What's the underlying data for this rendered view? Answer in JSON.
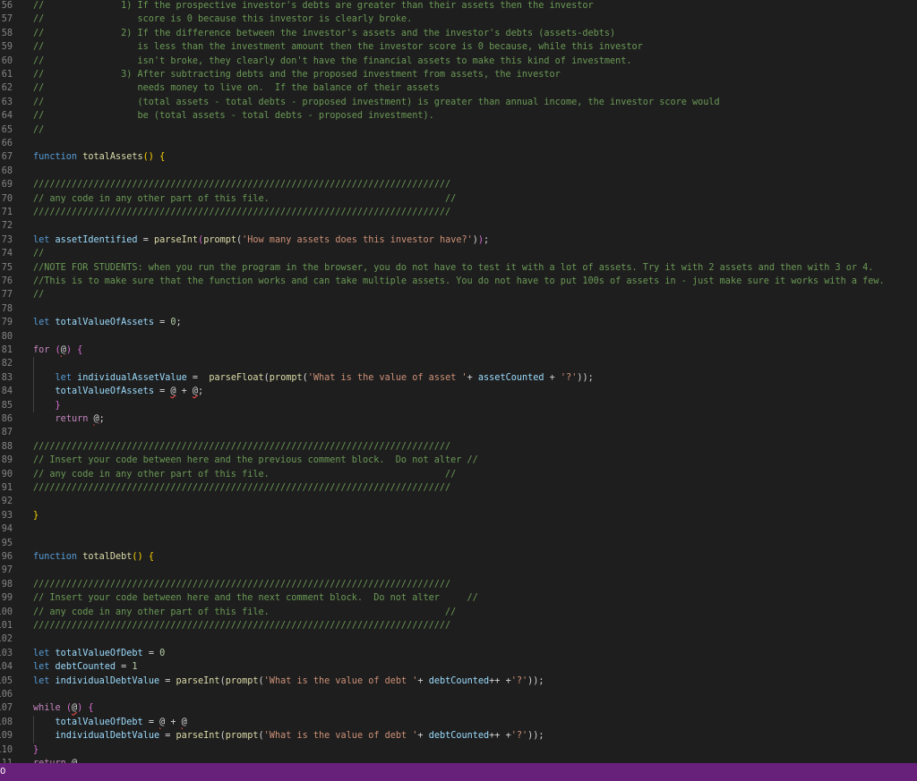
{
  "editor": {
    "first_line_number": 56,
    "lines": [
      [
        [
          "comment",
          "//              1) If the prospective investor's debts are greater than their assets then the investor"
        ]
      ],
      [
        [
          "comment",
          "//                 score is 0 because this investor is clearly broke."
        ]
      ],
      [
        [
          "comment",
          "//              2) If the difference between the investor's assets and the investor's debts (assets-debts)"
        ]
      ],
      [
        [
          "comment",
          "//                 is less than the investment amount then the investor score is 0 because, while this investor"
        ]
      ],
      [
        [
          "comment",
          "//                 isn't broke, they clearly don't have the financial assets to make this kind of investment."
        ]
      ],
      [
        [
          "comment",
          "//              3) After subtracting debts and the proposed investment from assets, the investor"
        ]
      ],
      [
        [
          "comment",
          "//                 needs money to live on.  If the balance of their assets"
        ]
      ],
      [
        [
          "comment",
          "//                 (total assets - total debts - proposed investment) is greater than annual income, the investor score would"
        ]
      ],
      [
        [
          "comment",
          "//                 be (total assets - total debts - proposed investment)."
        ]
      ],
      [
        [
          "comment",
          "//"
        ]
      ],
      [],
      [
        [
          "kw",
          "function "
        ],
        [
          "fn",
          "totalAssets"
        ],
        [
          "brace",
          "()"
        ],
        [
          "plain",
          " "
        ],
        [
          "brace",
          "{"
        ]
      ],
      [],
      [
        [
          "comment",
          "////////////////////////////////////////////////////////////////////////////"
        ]
      ],
      [
        [
          "comment",
          "// any code in any other part of this file.                                //"
        ]
      ],
      [
        [
          "comment",
          "////////////////////////////////////////////////////////////////////////////"
        ]
      ],
      [],
      [
        [
          "kw",
          "let "
        ],
        [
          "var",
          "assetIdentified"
        ],
        [
          "plain",
          " = "
        ],
        [
          "fn",
          "parseInt"
        ],
        [
          "brace2",
          "("
        ],
        [
          "fn",
          "prompt"
        ],
        [
          "plain",
          "("
        ],
        [
          "str",
          "'How many assets does this investor have?'"
        ],
        [
          "plain",
          ")"
        ],
        [
          "brace2",
          ")"
        ],
        [
          "plain",
          ";"
        ]
      ],
      [
        [
          "comment",
          "//"
        ]
      ],
      [
        [
          "comment",
          "//NOTE FOR STUDENTS: when you run the program in the browser, you do not have to test it with a lot of assets. Try it with 2 assets and then with 3 or 4."
        ]
      ],
      [
        [
          "comment",
          "//This is to make sure that the function works and can take multiple assets. You do not have to put 100s of assets in - just make sure it works with a few."
        ]
      ],
      [
        [
          "comment",
          "//"
        ]
      ],
      [],
      [
        [
          "kw",
          "let "
        ],
        [
          "var",
          "totalValueOfAssets"
        ],
        [
          "plain",
          " = "
        ],
        [
          "num",
          "0"
        ],
        [
          "plain",
          ";"
        ]
      ],
      [],
      [
        [
          "ctrl",
          "for "
        ],
        [
          "brace2",
          "("
        ],
        [
          "ph",
          "@"
        ],
        [
          "brace2",
          ")"
        ],
        [
          "plain",
          " "
        ],
        [
          "brace2",
          "{"
        ]
      ],
      [],
      [
        [
          "plain",
          "    "
        ],
        [
          "kw",
          "let "
        ],
        [
          "var",
          "individualAssetValue"
        ],
        [
          "plain",
          " =  "
        ],
        [
          "fn",
          "parseFloat"
        ],
        [
          "plain",
          "("
        ],
        [
          "fn",
          "prompt"
        ],
        [
          "plain",
          "("
        ],
        [
          "str",
          "'What is the value of asset '"
        ],
        [
          "plain",
          "+ "
        ],
        [
          "var",
          "assetCounted"
        ],
        [
          "plain",
          " + "
        ],
        [
          "str",
          "'?'"
        ],
        [
          "plain",
          "));"
        ]
      ],
      [
        [
          "plain",
          "    "
        ],
        [
          "var",
          "totalValueOfAssets"
        ],
        [
          "plain",
          " = "
        ],
        [
          "ph",
          "@"
        ],
        [
          "plain",
          " + "
        ],
        [
          "ph",
          "@"
        ],
        [
          "plain",
          ";"
        ]
      ],
      [
        [
          "plain",
          "    "
        ],
        [
          "brace2",
          "}"
        ]
      ],
      [
        [
          "plain",
          "    "
        ],
        [
          "ctrl",
          "return "
        ],
        [
          "ph",
          "@"
        ],
        [
          "plain",
          ";"
        ]
      ],
      [],
      [
        [
          "comment",
          "////////////////////////////////////////////////////////////////////////////"
        ]
      ],
      [
        [
          "comment",
          "// Insert your code between here and the previous comment block.  Do not alter //"
        ]
      ],
      [
        [
          "comment",
          "// any code in any other part of this file.                                //"
        ]
      ],
      [
        [
          "comment",
          "////////////////////////////////////////////////////////////////////////////"
        ]
      ],
      [],
      [
        [
          "brace",
          "}"
        ]
      ],
      [],
      [],
      [
        [
          "kw",
          "function "
        ],
        [
          "fn",
          "totalDebt"
        ],
        [
          "brace",
          "()"
        ],
        [
          "plain",
          " "
        ],
        [
          "brace",
          "{"
        ]
      ],
      [],
      [
        [
          "comment",
          "////////////////////////////////////////////////////////////////////////////"
        ]
      ],
      [
        [
          "comment",
          "// Insert your code between here and the next comment block.  Do not alter     //"
        ]
      ],
      [
        [
          "comment",
          "// any code in any other part of this file.                                //"
        ]
      ],
      [
        [
          "comment",
          "////////////////////////////////////////////////////////////////////////////"
        ]
      ],
      [],
      [
        [
          "kw",
          "let "
        ],
        [
          "var",
          "totalValueOfDebt"
        ],
        [
          "plain",
          " = "
        ],
        [
          "num",
          "0"
        ]
      ],
      [
        [
          "kw",
          "let "
        ],
        [
          "var",
          "debtCounted"
        ],
        [
          "plain",
          " = "
        ],
        [
          "num",
          "1"
        ]
      ],
      [
        [
          "kw",
          "let "
        ],
        [
          "var",
          "individualDebtValue"
        ],
        [
          "plain",
          " = "
        ],
        [
          "fn",
          "parseInt"
        ],
        [
          "plain",
          "("
        ],
        [
          "fn",
          "prompt"
        ],
        [
          "plain",
          "("
        ],
        [
          "str",
          "'What is the value of debt '"
        ],
        [
          "plain",
          "+ "
        ],
        [
          "var",
          "debtCounted"
        ],
        [
          "plain",
          "++ +"
        ],
        [
          "str",
          "'?'"
        ],
        [
          "plain",
          "));"
        ]
      ],
      [],
      [
        [
          "ctrl",
          "while "
        ],
        [
          "brace2",
          "("
        ],
        [
          "ph",
          "@"
        ],
        [
          "brace2",
          ")"
        ],
        [
          "plain",
          " "
        ],
        [
          "brace2",
          "{"
        ]
      ],
      [
        [
          "plain",
          "    "
        ],
        [
          "var",
          "totalValueOfDebt"
        ],
        [
          "plain",
          " = "
        ],
        [
          "ph",
          "@"
        ],
        [
          "plain",
          " + "
        ],
        [
          "ph",
          "@"
        ]
      ],
      [
        [
          "plain",
          "    "
        ],
        [
          "var",
          "individualDebtValue"
        ],
        [
          "plain",
          " = "
        ],
        [
          "fn",
          "parseInt"
        ],
        [
          "plain",
          "("
        ],
        [
          "fn",
          "prompt"
        ],
        [
          "plain",
          "("
        ],
        [
          "str",
          "'What is the value of debt '"
        ],
        [
          "plain",
          "+ "
        ],
        [
          "var",
          "debtCounted"
        ],
        [
          "plain",
          "++ +"
        ],
        [
          "str",
          "'?'"
        ],
        [
          "plain",
          "));"
        ]
      ],
      [
        [
          "brace2",
          "}"
        ]
      ],
      [
        [
          "ctrl",
          "return "
        ],
        [
          "ph",
          "@"
        ]
      ]
    ]
  },
  "statusbar": {
    "left_text": "0",
    "color": "#68217a"
  },
  "colors": {
    "background": "#1e1e1e",
    "comment": "#6a9955",
    "keyword": "#569cd6",
    "function": "#dcdcaa",
    "variable": "#9cdcfe",
    "string": "#ce9178"
  }
}
